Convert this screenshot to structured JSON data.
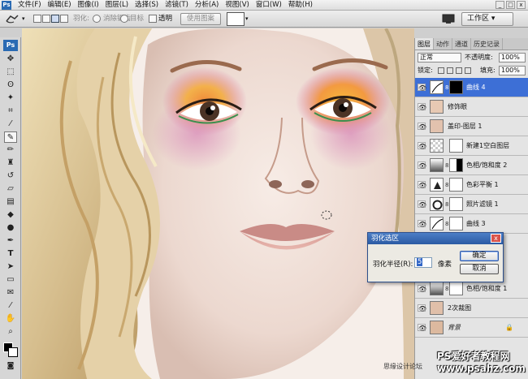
{
  "app": {
    "logo": "Ps"
  },
  "menu": {
    "items": [
      "文件(F)",
      "编辑(E)",
      "图像(I)",
      "图层(L)",
      "选择(S)",
      "滤镜(T)",
      "分析(A)",
      "视图(V)",
      "窗口(W)",
      "帮助(H)"
    ],
    "window_controls": [
      "_",
      "□",
      "x"
    ]
  },
  "options": {
    "feather_label": "羽化:",
    "feather_value": "",
    "antialias_label": "消除锯齿",
    "target_label": "目标",
    "transparent_label": "透明",
    "use_pattern_label": "使用图案",
    "workspace_label": "工作区 ▾"
  },
  "toolbox": {
    "badge": "Ps"
  },
  "layers_panel": {
    "tabs": [
      "图层",
      "动作",
      "通道",
      "历史记录"
    ],
    "blend_mode": "正常",
    "opacity_label": "不透明度:",
    "opacity_value": "100%",
    "lock_label": "锁定:",
    "fill_label": "填充:",
    "fill_value": "100%",
    "layers": [
      {
        "name": "曲线 4",
        "selected": true
      },
      {
        "name": "修饰眼",
        "selected": false
      },
      {
        "name": "盖印-图层 1",
        "selected": false
      },
      {
        "name": "新建1空白图层",
        "selected": false
      },
      {
        "name": "色相/饱和度 2",
        "selected": false
      },
      {
        "name": "色彩平衡 1",
        "selected": false
      },
      {
        "name": "照片滤镜 1",
        "selected": false
      },
      {
        "name": "曲线 3",
        "selected": false
      },
      {
        "name": "色相/饱和度 1",
        "selected": false
      },
      {
        "name": "2次裁图",
        "selected": false
      },
      {
        "name": "背景",
        "selected": false
      }
    ]
  },
  "dialog": {
    "title": "羽化选区",
    "close": "x",
    "radius_label": "羽化半径(R):",
    "radius_value": "5",
    "unit": "像素",
    "ok_label": "确定",
    "cancel_label": "取消"
  },
  "watermark": {
    "line1": "PS爱好者教程网",
    "line2": "www.psahz.com",
    "site_text": "思缘设计论坛"
  },
  "colors": {
    "selection_blue": "#3d6fd6",
    "dialog_title": "#2b5aa3",
    "ps_blue": "#2a6ab3"
  }
}
